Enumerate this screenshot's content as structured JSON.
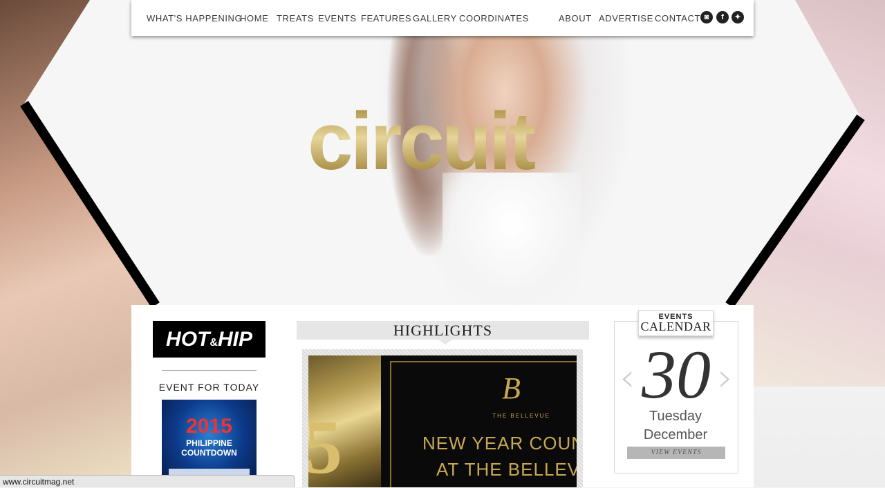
{
  "nav": {
    "items": [
      "WHAT'S HAPPENING",
      "HOME",
      "TREATS",
      "EVENTS",
      "FEATURES",
      "GALLERY",
      "COORDINATES"
    ],
    "right_items": [
      "ABOUT",
      "ADVERTISE",
      "CONTACT"
    ],
    "social": [
      "instagram-icon",
      "facebook-icon",
      "twitter-icon"
    ]
  },
  "hero": {
    "logo_text": "circuit"
  },
  "left_col": {
    "badge_main": "HOT",
    "badge_amp": "&",
    "badge_tail": "HIP",
    "event_heading": "EVENT FOR TODAY",
    "event_thumb": {
      "year": "2015",
      "line1": "PHILIPPINE",
      "line2": "COUNTDOWN"
    }
  },
  "highlights": {
    "title": "HIGHLIGHTS",
    "number": "5",
    "brand_letter": "B",
    "brand_name": "THE BELLEVUE",
    "headline1": "NEW YEAR COUNTDOWN P",
    "headline2": "AT THE BELLEVUE MAN"
  },
  "calendar": {
    "tag_top": "EVENTS",
    "tag_bottom": "CALENDAR",
    "day": "30",
    "weekday": "Tuesday",
    "month": "December",
    "button": "VIEW EVENTS"
  },
  "statusbar": {
    "url": "www.circuitmag.net"
  },
  "colors": {
    "accent_gold": "#b49a52",
    "nav_text": "#3a3a3a",
    "calendar_button": "#b6b6b6"
  }
}
